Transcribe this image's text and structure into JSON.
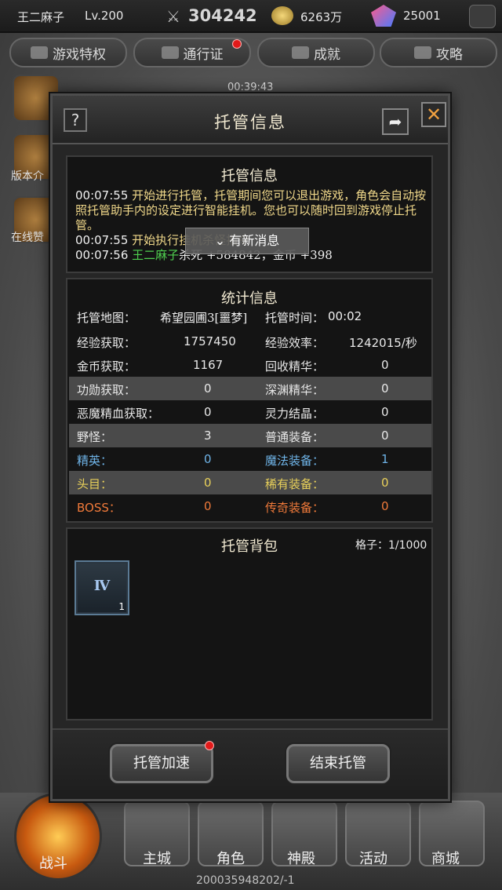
{
  "topbar": {
    "player_name": "王二麻子",
    "level": "Lv.200",
    "combat_power": "304242",
    "gold": "6263万",
    "diamonds": "25001"
  },
  "tabs": [
    "游戏特权",
    "通行证",
    "成就",
    "攻略"
  ],
  "timer": "00:39:43",
  "modal": {
    "title": "托管信息",
    "help_label": "?",
    "log_panel": {
      "title": "托管信息",
      "lines": [
        {
          "time": "00:07:55",
          "text": "开始进行托管，托管期间您可以退出游戏，角色会自动按照托管助手内的设定进行智能挂机。您也可以随时回到游戏停止托管。"
        },
        {
          "time": "00:07:55",
          "text": "开始执行挂机杀怪指令"
        },
        {
          "time": "00:07:56",
          "name": "王二麻子",
          "text": "杀死",
          "exp": "+584842，金币",
          "gold": "+398"
        }
      ],
      "toast": "有新消息"
    },
    "stats_panel": {
      "title": "统计信息",
      "map_label": "托管地图：",
      "map_value": "希望园圃3[噩梦]",
      "time_label": "托管时间：",
      "time_value": "00:02",
      "rows": [
        {
          "l1": "经验获取：",
          "v1": "1757450",
          "l2": "经验效率：",
          "v2": "1242015/秒"
        },
        {
          "l1": "金币获取：",
          "v1": "1167",
          "l2": "回收精华：",
          "v2": "0"
        },
        {
          "l1": "功勋获取：",
          "v1": "0",
          "l2": "深渊精华：",
          "v2": "0"
        },
        {
          "l1": "恶魔精血获取：",
          "v1": "0",
          "l2": "灵力结晶：",
          "v2": "0"
        },
        {
          "l1": "野怪：",
          "v1": "3",
          "l2": "普通装备：",
          "v2": "0"
        },
        {
          "l1": "精英：",
          "v1": "0",
          "l2": "魔法装备：",
          "v2": "1"
        },
        {
          "l1": "头目：",
          "v1": "0",
          "l2": "稀有装备：",
          "v2": "0"
        },
        {
          "l1": "BOSS：",
          "v1": "0",
          "l2": "传奇装备：",
          "v2": "0"
        }
      ]
    },
    "bag_panel": {
      "title": "托管背包",
      "capacity": "格子：1/1000",
      "slot_label": "Ⅳ",
      "slot_count": "1"
    },
    "speed_button": "托管加速",
    "end_button": "结束托管"
  },
  "side_labels": [
    "版本介",
    "在线赞"
  ],
  "bottom_nav": [
    "战斗",
    "主城",
    "角色",
    "神殿",
    "活动",
    "商城"
  ],
  "footer_id": "200035948202/-1",
  "colors": {
    "white_stat": "#e8e8e8",
    "magic_stat": "#6fb4e8",
    "rare_stat": "#e8d05a",
    "legend_stat": "#f07a3a",
    "log_text": "#f0d88a"
  }
}
